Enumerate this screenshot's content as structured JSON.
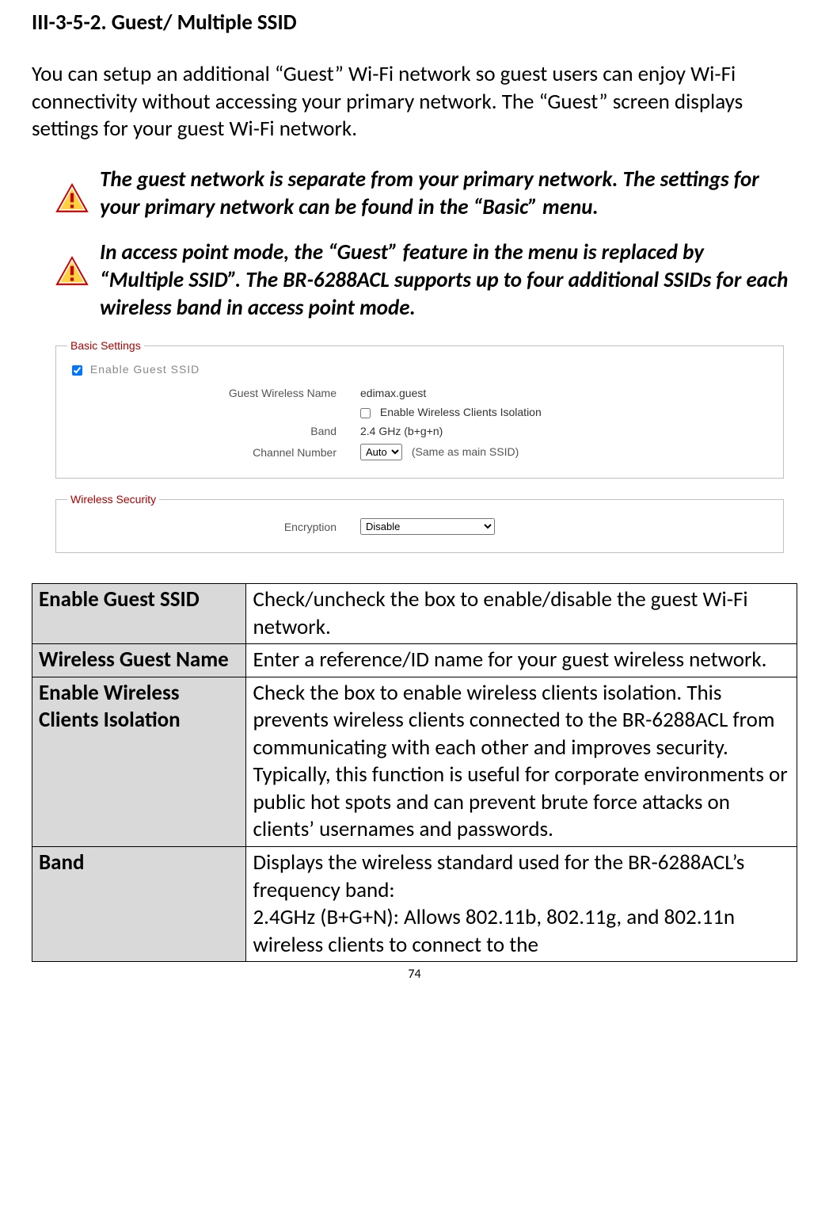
{
  "heading": "III-3-5-2.    Guest/ Multiple SSID",
  "intro": "You can setup an additional “Guest” Wi-Fi network so guest users can enjoy Wi-Fi connectivity without accessing your primary network. The “Guest” screen displays settings for your guest Wi-Fi network.",
  "note1": "The guest network is separate from your primary network. The settings for your primary network can be found in the “Basic” menu.",
  "note2": "In access point mode, the “Guest” feature in the menu is replaced by “Multiple SSID”. The BR-6288ACL supports up to four additional SSIDs for each wireless band in access point mode.",
  "config": {
    "basic_legend": "Basic Settings",
    "enable_guest_ssid": "Enable  Guest  SSID",
    "guest_wireless_name_label": "Guest Wireless Name",
    "guest_wireless_name_value": "edimax.guest",
    "client_isolation": "Enable Wireless Clients Isolation",
    "band_label": "Band",
    "band_value": "2.4 GHz (b+g+n)",
    "channel_label": "Channel Number",
    "channel_value": "Auto",
    "channel_note": "(Same as main SSID)",
    "security_legend": "Wireless  Security",
    "encryption_label": "Encryption",
    "encryption_value": "Disable"
  },
  "table": {
    "row1_label": "Enable Guest SSID",
    "row1_desc": "Check/uncheck the box to enable/disable the guest Wi-Fi network.",
    "row2_label": "Wireless Guest Name",
    "row2_desc": "Enter a reference/ID name for your guest wireless network.",
    "row3_label": "Enable Wireless Clients Isolation",
    "row3_desc": "Check the box to enable wireless clients isolation. This prevents wireless clients connected to the BR-6288ACL from communicating with each other and improves security. Typically, this function is useful for corporate environments or public hot spots and can prevent brute force attacks on clients’ usernames and passwords.",
    "row4_label": "Band",
    "row4_desc": "Displays the wireless standard used for the BR-6288ACL’s frequency band:\n2.4GHz (B+G+N): Allows 802.11b, 802.11g, and 802.11n wireless clients to connect to the"
  },
  "page_number": "74"
}
